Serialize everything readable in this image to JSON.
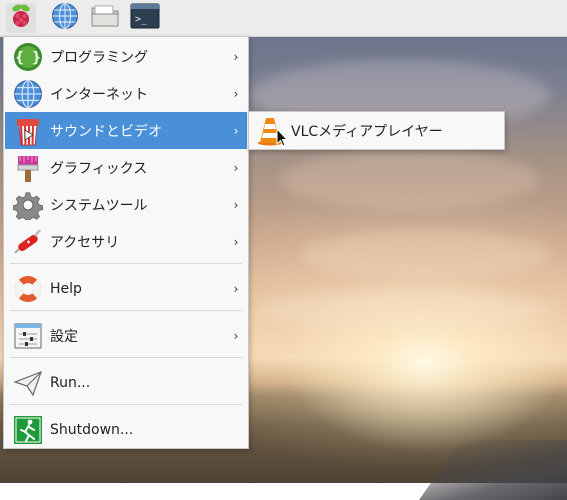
{
  "taskbar": {
    "buttons": [
      {
        "name": "raspberry-menu",
        "icon": "raspberry-icon"
      },
      {
        "name": "web-browser",
        "icon": "globe-icon"
      },
      {
        "name": "file-manager",
        "icon": "folder-icon"
      },
      {
        "name": "terminal",
        "icon": "terminal-icon",
        "text": ">_"
      }
    ]
  },
  "main_menu": {
    "items": [
      {
        "label": "プログラミング",
        "icon": "programming-icon",
        "has_submenu": true
      },
      {
        "label": "インターネット",
        "icon": "globe-icon",
        "has_submenu": true
      },
      {
        "label": "サウンドとビデオ",
        "icon": "sound-video-icon",
        "has_submenu": true,
        "highlighted": true
      },
      {
        "label": "グラフィックス",
        "icon": "paint-brush-icon",
        "has_submenu": true
      },
      {
        "label": "システムツール",
        "icon": "gear-icon",
        "has_submenu": true
      },
      {
        "label": "アクセサリ",
        "icon": "swiss-knife-icon",
        "has_submenu": true
      },
      {
        "label": "Help",
        "icon": "lifebuoy-icon",
        "has_submenu": true
      },
      {
        "label": "設定",
        "icon": "settings-panel-icon",
        "has_submenu": true
      },
      {
        "label": "Run...",
        "icon": "paper-plane-icon",
        "has_submenu": false
      },
      {
        "label": "Shutdown...",
        "icon": "exit-icon",
        "has_submenu": false
      }
    ],
    "arrow": "›"
  },
  "sub_menu": {
    "items": [
      {
        "label": "VLCメディアプレイヤー",
        "icon": "vlc-cone-icon"
      }
    ]
  },
  "colors": {
    "highlight": "#4a90d9",
    "menu_bg": "#f8f8f8",
    "taskbar_bg": "#ececec"
  }
}
